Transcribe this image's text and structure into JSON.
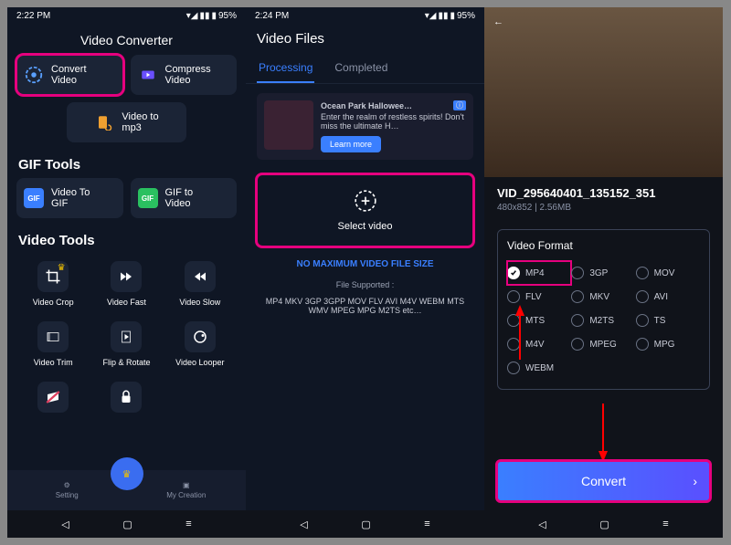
{
  "phone1": {
    "status": {
      "time": "2:22 PM",
      "battery": "95%"
    },
    "title": "Video Converter",
    "tiles": {
      "convert": "Convert\nVideo",
      "compress": "Compress\nVideo",
      "tomp3": "Video to\nmp3"
    },
    "section_gif": "GIF Tools",
    "gif_tiles": {
      "togif": "Video To\nGIF",
      "tovideo": "GIF to\nVideo"
    },
    "section_video": "Video Tools",
    "grid": {
      "crop": "Video Crop",
      "fast": "Video Fast",
      "slow": "Video Slow",
      "trim": "Video Trim",
      "flip": "Flip & Rotate",
      "looper": "Video Looper"
    },
    "nav": {
      "setting": "Setting",
      "creation": "My Creation"
    }
  },
  "phone2": {
    "status": {
      "time": "2:24 PM",
      "battery": "95%"
    },
    "title": "Video Files",
    "tabs": {
      "processing": "Processing",
      "completed": "Completed"
    },
    "ad": {
      "title": "Ocean Park Hallowee…",
      "desc": "Enter the realm of restless spirits! Don't miss the ultimate H…",
      "btn": "Learn more"
    },
    "select": "Select video",
    "blue": "NO MAXIMUM VIDEO FILE SIZE",
    "supported_label": "File Supported :",
    "supported": "MP4 MKV 3GP 3GPP MOV FLV AVI M4V WEBM MTS WMV MPEG MPG M2TS etc…"
  },
  "phone3": {
    "file": {
      "name": "VID_295640401_135152_351",
      "info": "480x852  |  2.56MB"
    },
    "format_title": "Video Format",
    "formats": [
      "MP4",
      "3GP",
      "MOV",
      "FLV",
      "MKV",
      "AVI",
      "MTS",
      "M2TS",
      "TS",
      "M4V",
      "MPEG",
      "MPG",
      "WEBM"
    ],
    "selected": "MP4",
    "convert": "Convert"
  }
}
